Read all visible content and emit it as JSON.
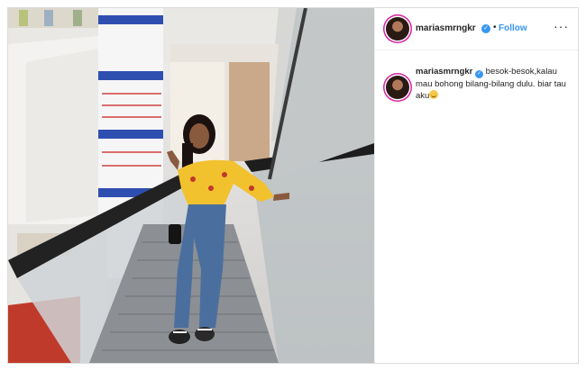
{
  "post": {
    "username": "mariasmrngkr",
    "verified_mark": "✓",
    "separator": "•",
    "follow_label": "Follow",
    "more_label": "···",
    "caption_text": "besok-besok,kalau mau bohong bilang-bilang dulu. biar tau aku",
    "caption_emoji": "smiling-face-icon"
  },
  "colors": {
    "accent": "#3897f0",
    "shirt": "#f2c12e",
    "jeans": "#4a6f9e"
  },
  "icons": {
    "more": "more-options-icon",
    "verified": "verified-badge-icon"
  }
}
